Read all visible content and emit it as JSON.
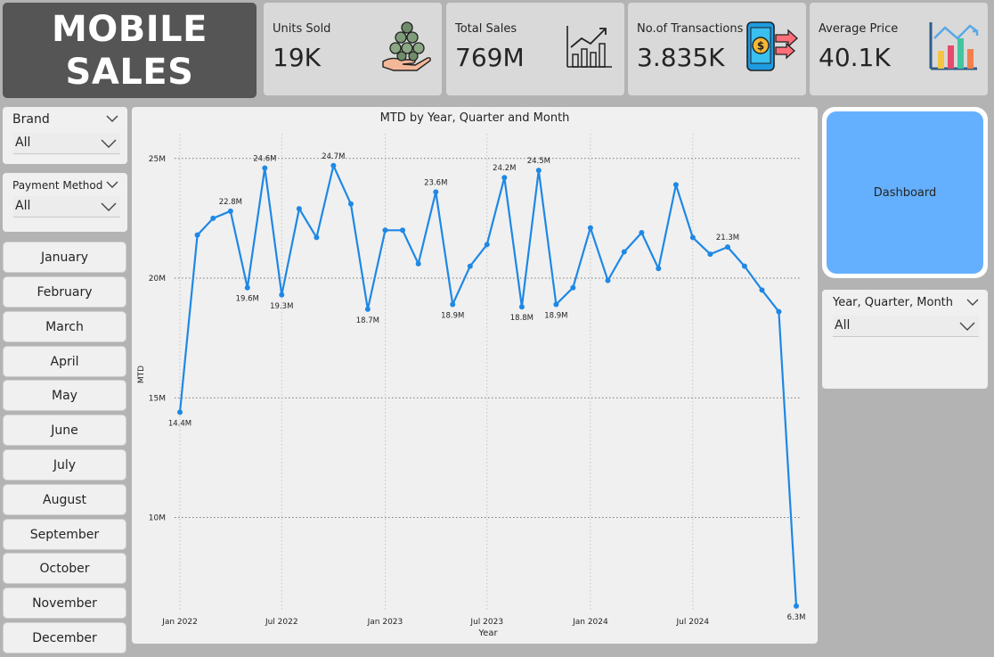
{
  "title": {
    "line1": "MOBILE",
    "line2": "SALES"
  },
  "kpis": [
    {
      "label": "Units Sold",
      "value": "19K",
      "icon": "coins-hand-icon"
    },
    {
      "label": "Total Sales",
      "value": "769M",
      "icon": "growth-chart-icon"
    },
    {
      "label": "No.of Transactions",
      "value": "3.835K",
      "icon": "phone-payment-icon"
    },
    {
      "label": "Average Price",
      "value": "40.1K",
      "icon": "bar-chart-icon"
    }
  ],
  "slicers": {
    "brand": {
      "title": "Brand",
      "value": "All"
    },
    "payment": {
      "title": "Payment Method",
      "value": "All"
    },
    "yqm": {
      "title": "Year, Quarter, Month",
      "value": "All"
    }
  },
  "months": [
    "January",
    "February",
    "March",
    "April",
    "May",
    "June",
    "July",
    "August",
    "September",
    "October",
    "November",
    "December"
  ],
  "dashboard_button": "Dashboard",
  "colors": {
    "line": "#1e88e5",
    "accent_button": "#64b0ff",
    "title_bg": "#555555"
  },
  "chart_data": {
    "type": "line",
    "title": "MTD by Year, Quarter and Month",
    "xlabel": "Year",
    "ylabel": "MTD",
    "x": [
      "2021-12",
      "2022-01",
      "2022-02",
      "2022-03",
      "2022-04",
      "2022-05",
      "2022-06",
      "2022-07",
      "2022-08",
      "2022-09",
      "2022-10",
      "2022-11",
      "2022-12",
      "2023-01",
      "2023-02",
      "2023-03",
      "2023-04",
      "2023-05",
      "2023-06",
      "2023-07",
      "2023-08",
      "2023-09",
      "2023-10",
      "2023-11",
      "2023-12",
      "2024-01",
      "2024-02",
      "2024-03",
      "2024-04",
      "2024-05",
      "2024-06",
      "2024-07",
      "2024-08",
      "2024-09",
      "2024-10"
    ],
    "x_ticks": [
      {
        "label": "Jan 2022",
        "at": "2022-01"
      },
      {
        "label": "Jul 2022",
        "at": "2022-07"
      },
      {
        "label": "Jan 2023",
        "at": "2023-01"
      },
      {
        "label": "Jul 2023",
        "at": "2023-07"
      },
      {
        "label": "Jan 2024",
        "at": "2024-01"
      },
      {
        "label": "Jul 2024",
        "at": "2024-07"
      }
    ],
    "y_ticks": [
      "10M",
      "15M",
      "20M",
      "25M"
    ],
    "ylim": [
      10,
      25
    ],
    "series": [
      {
        "values": [
          14.4,
          21.8,
          22.5,
          22.8,
          19.6,
          24.6,
          19.3,
          22.9,
          21.7,
          24.7,
          23.1,
          18.7,
          22.0,
          22.0,
          20.6,
          23.6,
          18.9,
          20.5,
          21.4,
          24.2,
          18.8,
          24.5,
          18.9,
          19.6,
          22.1,
          19.9,
          21.1,
          21.9,
          20.4,
          23.9,
          21.7,
          21.0,
          21.3,
          20.5,
          19.5,
          18.6,
          6.3
        ],
        "x": [
          "2022-01-01",
          "2022-02-01",
          "2022-03-01",
          "2022-04-01",
          "2022-05-01",
          "2022-06-01",
          "2022-07-01",
          "2022-08-01",
          "2022-09-01",
          "2022-10-01",
          "2022-11-01",
          "2022-12-01",
          "2023-01-01",
          "2023-02-01",
          "2023-03-01",
          "2023-04-01",
          "2023-05-01",
          "2023-06-01",
          "2023-07-01",
          "2023-08-01",
          "2023-09-01",
          "2023-10-01",
          "2023-11-01",
          "2023-12-01",
          "2024-01-01",
          "2024-02-01",
          "2024-03-01",
          "2024-04-01",
          "2024-05-01",
          "2024-06-01",
          "2024-07-01",
          "2024-08-01",
          "2024-09-01",
          "2024-10-01",
          "2024-11-01",
          "2024-12-01",
          "2025-01-01"
        ]
      }
    ],
    "data_labels": [
      {
        "point": 0,
        "text": "14.4M",
        "pos": "below"
      },
      {
        "point": 3,
        "text": "22.8M",
        "pos": "above"
      },
      {
        "point": 4,
        "text": "19.6M",
        "pos": "below"
      },
      {
        "point": 5,
        "text": "24.6M",
        "pos": "above"
      },
      {
        "point": 6,
        "text": "19.3M",
        "pos": "below"
      },
      {
        "point": 9,
        "text": "24.7M",
        "pos": "above"
      },
      {
        "point": 11,
        "text": "18.7M",
        "pos": "below"
      },
      {
        "point": 15,
        "text": "23.6M",
        "pos": "above"
      },
      {
        "point": 16,
        "text": "18.9M",
        "pos": "below"
      },
      {
        "point": 19,
        "text": "24.2M",
        "pos": "above"
      },
      {
        "point": 20,
        "text": "18.8M",
        "pos": "below"
      },
      {
        "point": 21,
        "text": "24.5M",
        "pos": "above"
      },
      {
        "point": 22,
        "text": "18.9M",
        "pos": "below"
      },
      {
        "point": 32,
        "text": "21.3M",
        "pos": "above"
      },
      {
        "point": 36,
        "text": "6.3M",
        "pos": "below"
      }
    ],
    "grid": true
  }
}
